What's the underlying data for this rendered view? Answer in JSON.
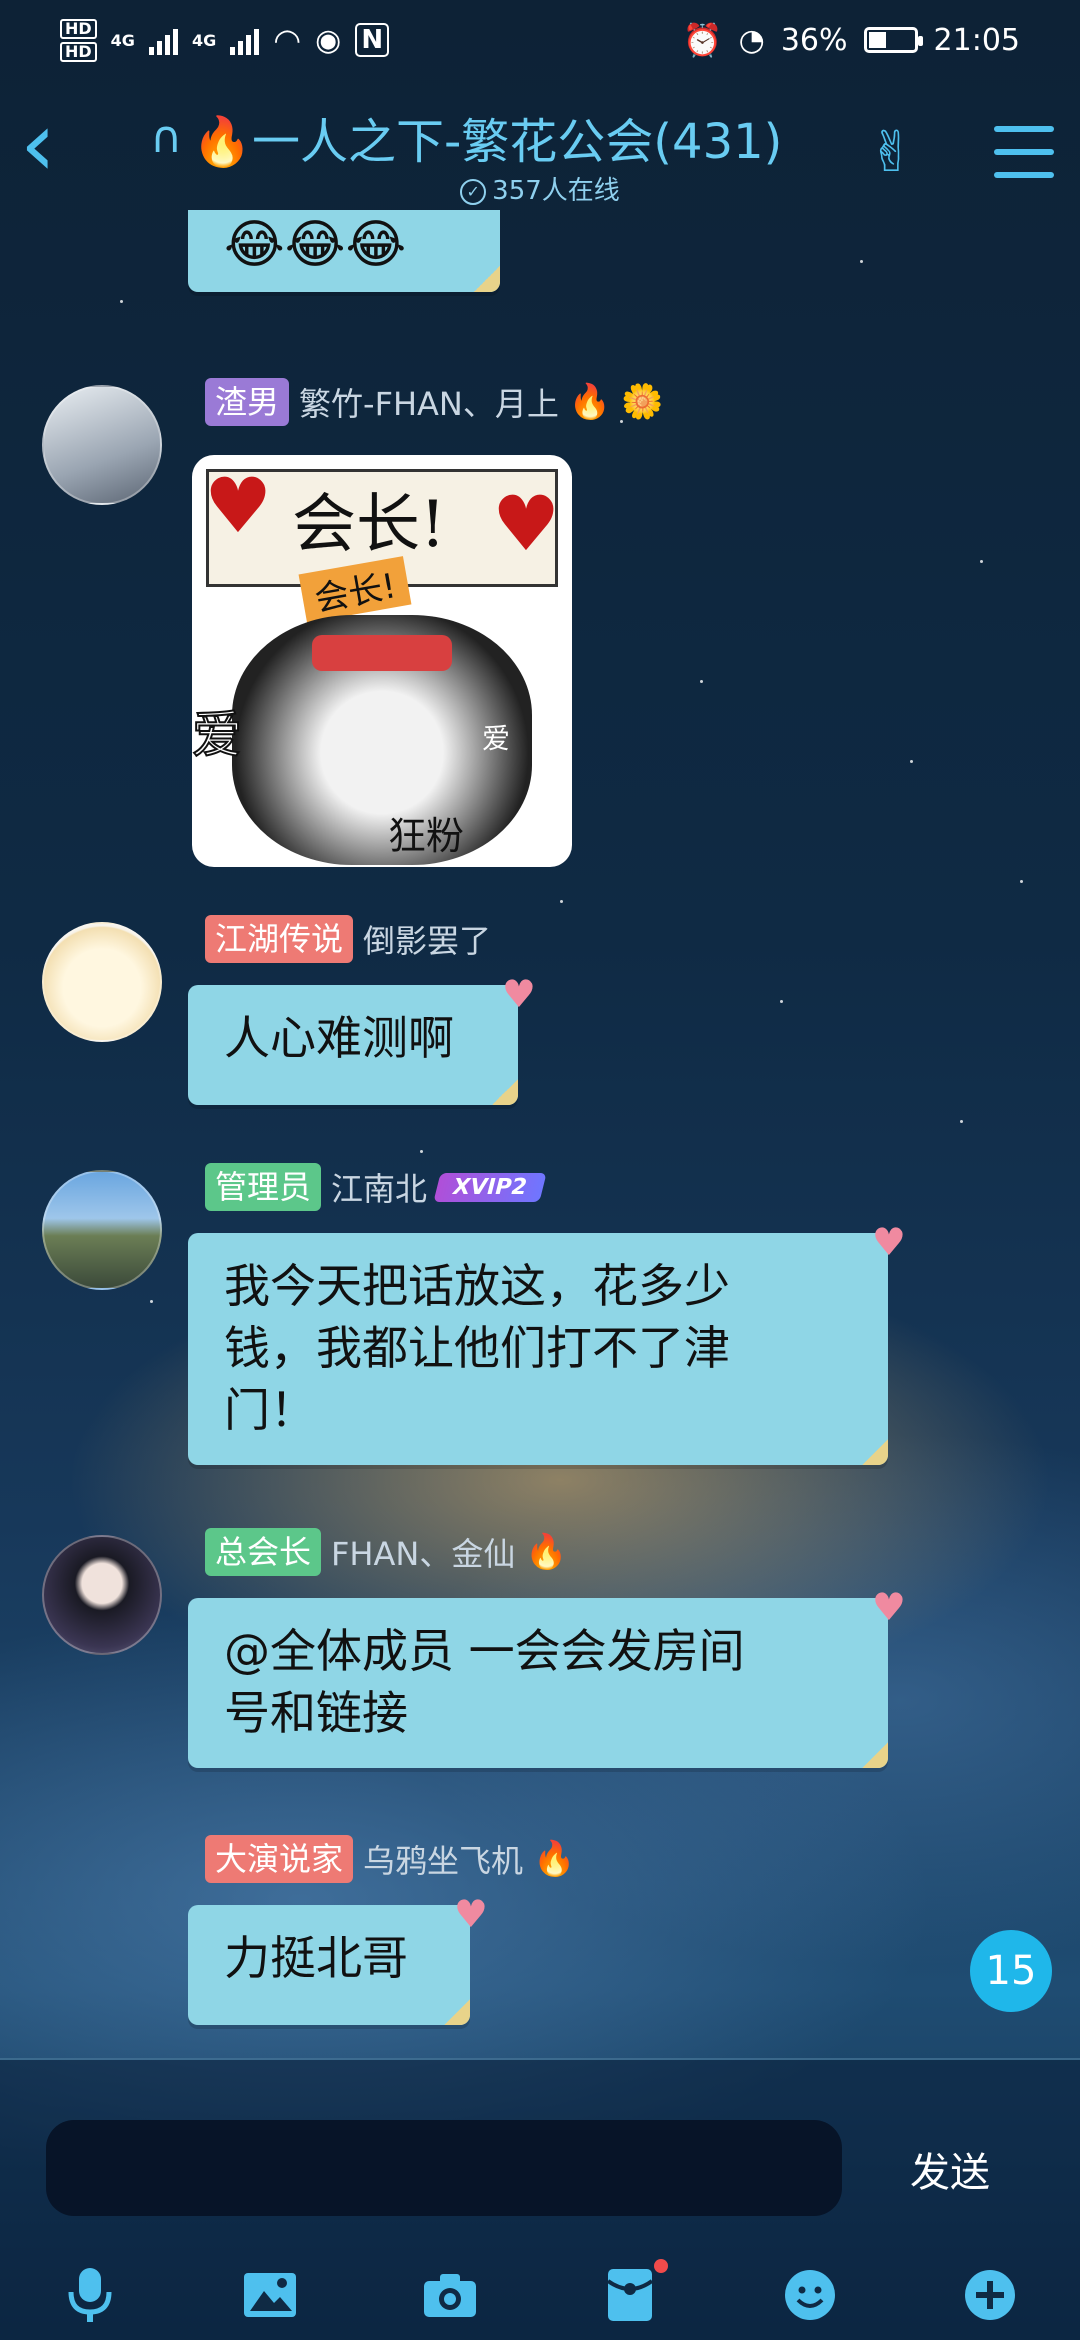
{
  "status_bar": {
    "battery": "36%",
    "time": "21:05",
    "net_labels": [
      "4G",
      "4G"
    ],
    "hd_labels": [
      "HD",
      "HD"
    ]
  },
  "header": {
    "title": "🔥一人之下-繁花公会(431)",
    "online": "357人在线"
  },
  "messages": [
    {
      "tag": "渣男",
      "name": "繁竹-FHAN、月上"
    },
    {
      "tag": "江湖传说",
      "name": "倒影罢了",
      "text": "人心难测啊"
    },
    {
      "tag": "管理员",
      "name": "江南北",
      "vip": "XVIP2",
      "text_lines": [
        "我今天把话放这，花多少",
        "钱，我都让他们打不了津",
        "门！"
      ]
    },
    {
      "tag": "总会长",
      "name": "FHAN、金仙",
      "text_lines": [
        "@全体成员  一会会发房间",
        "号和链接"
      ]
    },
    {
      "tag": "大演说家",
      "name": "乌鸦坐飞机",
      "text": "力挺北哥"
    }
  ],
  "sticker": {
    "top_text": "会长!",
    "banner_text": "会长!",
    "side_left": "爱",
    "side_right": "爱",
    "bottom_text": "狂粉"
  },
  "unread_badge": "15",
  "input": {
    "send_label": "发送"
  },
  "toolbar": {
    "icons": [
      "microphone-icon",
      "image-icon",
      "camera-icon",
      "red-packet-icon",
      "emoji-icon",
      "plus-icon"
    ]
  },
  "colors": {
    "accent": "#4ec0ee",
    "bubble": "#8fd6e6",
    "tag_purple": "#9a7ad6",
    "tag_red": "#ee7a74",
    "tag_green": "#5cc78a"
  }
}
